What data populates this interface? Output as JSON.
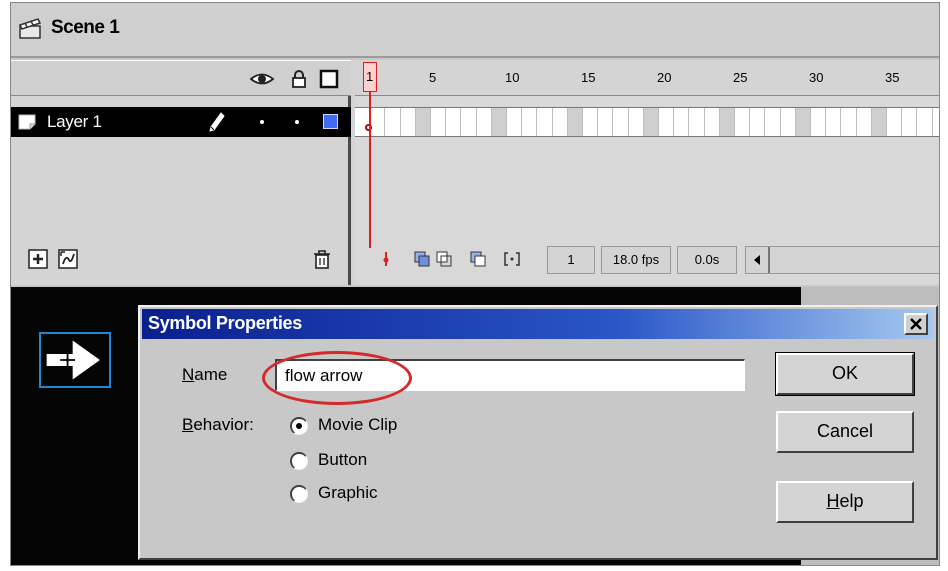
{
  "scene": {
    "title": "Scene 1",
    "icon": "clapperboard-icon"
  },
  "timeline": {
    "header_icons": [
      "eye-icon",
      "lock-icon",
      "outline-icon"
    ],
    "ruler_labels": [
      "5",
      "10",
      "15",
      "20",
      "25",
      "30",
      "35"
    ],
    "playhead_frame": "1",
    "layer": {
      "name": "Layer 1",
      "outline_color": "#3f6cf5"
    },
    "footer": {
      "current_frame": "1",
      "fps": "18.0 fps",
      "elapsed": "0.0s"
    }
  },
  "dialog": {
    "title": "Symbol Properties",
    "name_label_u": "N",
    "name_label_rest": "ame",
    "name_value": "flow arrow",
    "behavior_label_u": "B",
    "behavior_label_rest": "ehavior:",
    "options": [
      {
        "label": "Movie Clip",
        "checked": true
      },
      {
        "label": "Button",
        "checked": false
      },
      {
        "label": "Graphic",
        "checked": false
      }
    ],
    "ok": "OK",
    "cancel": "Cancel",
    "help_u": "H",
    "help_rest": "elp",
    "highlight_color": "#d32a2a"
  }
}
